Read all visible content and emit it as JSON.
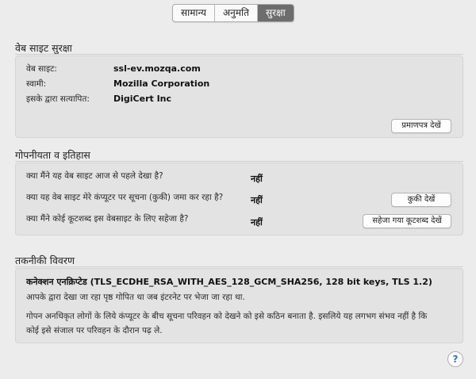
{
  "tabs": [
    {
      "label": "सामान्य",
      "selected": false
    },
    {
      "label": "अनुमति",
      "selected": false
    },
    {
      "label": "सुरक्षा",
      "selected": true
    }
  ],
  "website_security": {
    "title": "वेब साइट सुरक्षा",
    "website_label": "वेब साइट:",
    "website_value": "ssl-ev.mozqa.com",
    "owner_label": "स्वामी:",
    "owner_value": "Mozilla Corporation",
    "verified_label": "इसके द्वारा सत्यापित:",
    "verified_value": "DigiCert Inc",
    "view_certificate_button": "प्रमाणपत्र देखें"
  },
  "privacy_history": {
    "title": "गोपनीयता व इतिहास",
    "q1": "क्या मैंने यह वेब साइट आज से पहले देखा है?",
    "a1": "नहीं",
    "q2": "क्या यह वेब साइट मेरे कंप्यूटर पर सूचना (कुकी) जमा कर रहा है?",
    "a2": "नहीं",
    "view_cookies_button": "कुकी देखें",
    "q3": "क्या मैंने कोई कूटशब्द इस वेबसाइट के लिए सहेजा है?",
    "a3": "नहीं",
    "view_passwords_button": "सहेजा गया कूटशब्द देखें"
  },
  "technical_details": {
    "title": "तकनीकी विवरण",
    "heading": "कनेक्शन एनक्रिप्टेड (TLS_ECDHE_RSA_WITH_AES_128_GCM_SHA256, 128 bit keys, TLS 1.2)",
    "line1": "आपके द्वारा देखा जा रहा पृष्ठ गोपित था जब इंटरनेट पर भेजा जा रहा था.",
    "line2": "गोपन अनधिकृत लोगों के लिये कंप्यूटर के बीच सूचना परिवहन को देखने को इसे कठिन बनाता है. इसलिये यह लगभग संभव नहीं है कि",
    "line3": "कोई इसे संजाल पर परिवहन के दौरान पढ़ ले."
  },
  "help_button": "?"
}
